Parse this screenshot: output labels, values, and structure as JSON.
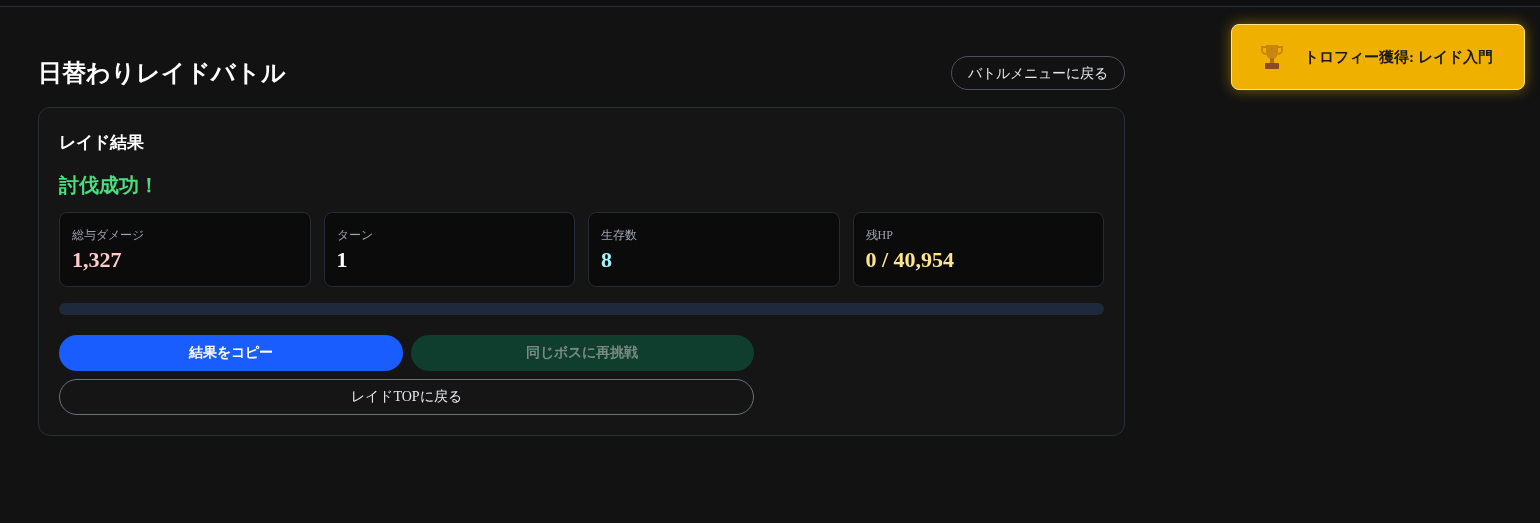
{
  "page": {
    "title": "日替わりレイドバトル",
    "back_button": "バトルメニューに戻る"
  },
  "result": {
    "heading": "レイド結果",
    "outcome": "討伐成功！",
    "stats": [
      {
        "label": "総与ダメージ",
        "value": "1,327",
        "color": "#fecaca"
      },
      {
        "label": "ターン",
        "value": "1",
        "color": "#ffffff"
      },
      {
        "label": "生存数",
        "value": "8",
        "color": "#a5f3fc"
      },
      {
        "label": "残HP",
        "value": "0 / 40,954",
        "color": "#fde68a"
      }
    ],
    "hp_bar": {
      "level": 0
    },
    "buttons": [
      {
        "label": "結果をコピー",
        "kind": "primary",
        "disabled": false
      },
      {
        "label": "同じボスに再挑戦",
        "kind": "success",
        "disabled": true
      },
      {
        "label": "レイドTOPに戻る",
        "kind": "outline",
        "disabled": false
      }
    ]
  },
  "toast": {
    "text": "トロフィー獲得: レイド入門"
  }
}
